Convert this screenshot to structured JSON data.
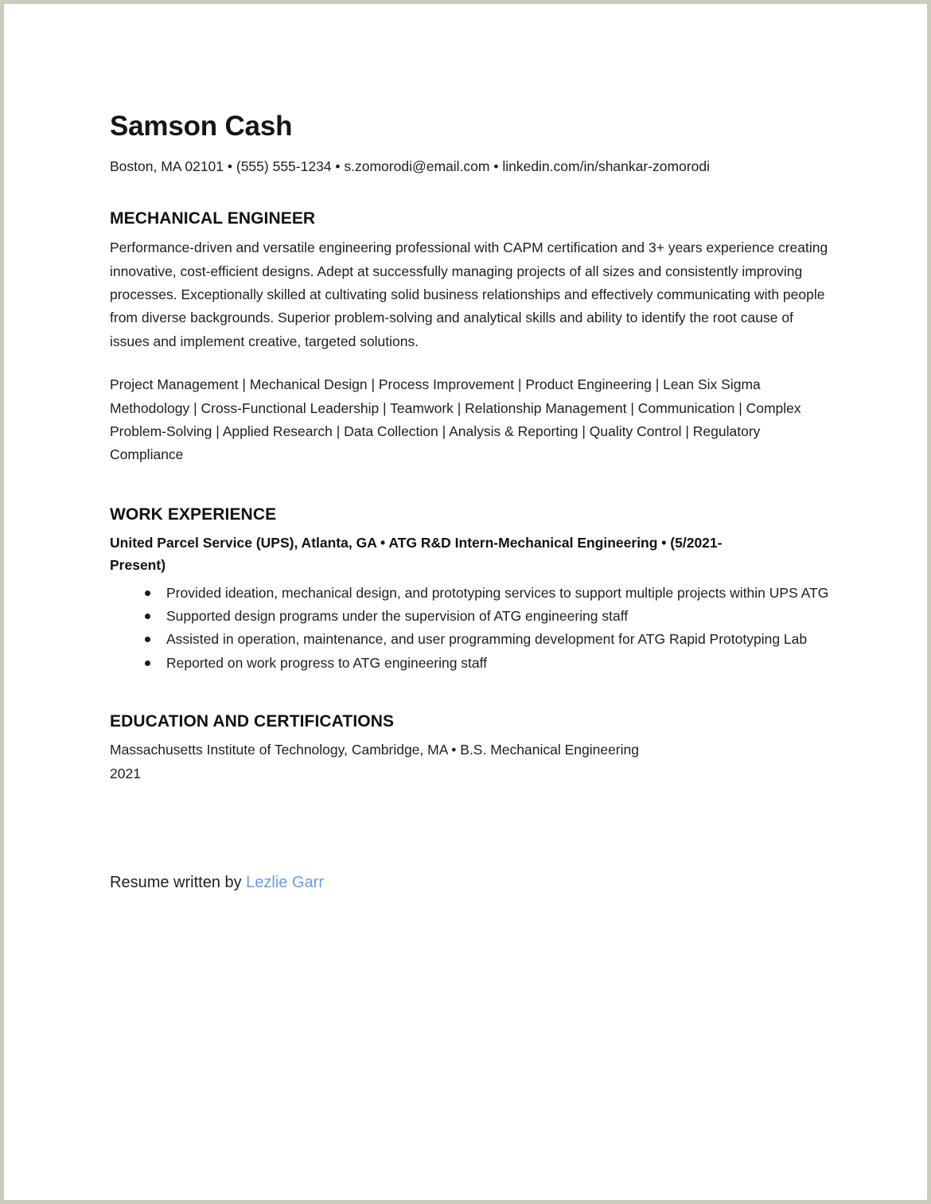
{
  "document": {
    "name": "Samson Cash",
    "contact": "Boston, MA 02101 • (555) 555-1234 • s.zomorodi@email.com • linkedin.com/in/shankar-zomorodi",
    "title_heading": "MECHANICAL ENGINEER",
    "summary": "Performance-driven and versatile engineering professional with CAPM certification and 3+ years experience creating innovative, cost-efficient designs. Adept at successfully managing projects of all sizes and consistently improving processes. Exceptionally skilled at cultivating solid business relationships and effectively communicating with people from diverse backgrounds. Superior problem-solving and analytical skills and ability to identify the root cause of issues and implement creative, targeted solutions.",
    "skills_line": "Project Management | Mechanical Design | Process Improvement | Product Engineering | Lean Six Sigma Methodology | Cross-Functional Leadership | Teamwork | Relationship Management | Communication | Complex Problem-Solving | Applied Research | Data Collection | Analysis & Reporting | Quality Control | Regulatory Compliance",
    "skills": [
      "Project Management",
      "Mechanical Design",
      "Process Improvement",
      "Product Engineering",
      "Lean Six Sigma Methodology",
      "Cross-Functional Leadership",
      "Teamwork",
      "Relationship Management",
      "Communication",
      "Complex Problem-Solving",
      "Applied Research",
      "Data Collection",
      "Analysis & Reporting",
      "Quality Control",
      "Regulatory Compliance"
    ],
    "work_experience": {
      "heading": "WORK EXPERIENCE",
      "job": {
        "header": "United Parcel Service (UPS), Atlanta, GA • ATG R&D Intern-Mechanical Engineering • (5/2021-Present)",
        "employer": "United Parcel Service (UPS)",
        "location": "Atlanta, GA",
        "role": "ATG R&D Intern-Mechanical Engineering",
        "dates": "(5/2021-Present)",
        "bullets": [
          "Provided ideation, mechanical design, and prototyping services to support multiple projects within UPS ATG",
          "Supported design programs under the supervision of ATG engineering staff",
          "Assisted in operation, maintenance, and user programming development for ATG Rapid Prototyping Lab",
          "Reported on work progress to ATG engineering staff"
        ]
      }
    },
    "education": {
      "heading": "EDUCATION AND CERTIFICATIONS",
      "entry_line_1": "Massachusetts Institute of Technology, Cambridge, MA • B.S. Mechanical Engineering",
      "entry_line_2": "2021",
      "institution": "Massachusetts Institute of Technology",
      "location": "Cambridge, MA",
      "degree": "B.S. Mechanical Engineering",
      "year": "2021"
    },
    "credit": {
      "prefix": "Resume written by ",
      "author": "Lezlie Garr"
    }
  },
  "colors": {
    "page_border": "#ccccbd",
    "body_text": "#1f1f1f",
    "heading_text": "#111111",
    "link_blue": "#6b9aec"
  }
}
